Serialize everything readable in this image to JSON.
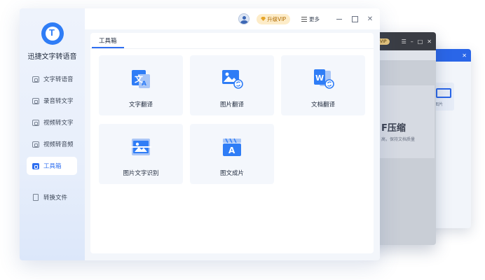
{
  "app": {
    "name": "迅捷文字转语音"
  },
  "sidebar": {
    "items": [
      {
        "label": "文字转语音",
        "icon": "text-to-speech-icon"
      },
      {
        "label": "录音转文字",
        "icon": "audio-to-text-icon"
      },
      {
        "label": "视频转文字",
        "icon": "video-to-text-icon"
      },
      {
        "label": "视频转音频",
        "icon": "video-to-audio-icon"
      },
      {
        "label": "工具箱",
        "icon": "toolbox-icon",
        "active": true
      },
      {
        "label": "转换文件",
        "icon": "file-icon"
      }
    ]
  },
  "topbar": {
    "vip_label": "升级VIP",
    "more_label": "更多"
  },
  "main": {
    "tab_label": "工具箱",
    "tools": [
      {
        "label": "文字翻译",
        "icon": "text-translate-icon"
      },
      {
        "label": "图片翻译",
        "icon": "image-translate-icon"
      },
      {
        "label": "文档翻译",
        "icon": "document-translate-icon"
      },
      {
        "label": "图片文字识别",
        "icon": "image-ocr-icon"
      },
      {
        "label": "图文成片",
        "icon": "image-text-to-video-icon"
      }
    ]
  },
  "background_windows": {
    "vip_badge": "VIP",
    "title_fragment": "F压缩",
    "subtitle_fragment": "高，保持文档质量",
    "card_fragment": "图片"
  },
  "colors": {
    "accent": "#2f6ff0",
    "logo": "#2f7df6",
    "vip_bg": "#fdecc8",
    "vip_text": "#b06b00",
    "sidebar_bg": "#eef3fc",
    "card_bg": "#f4f7fc"
  }
}
